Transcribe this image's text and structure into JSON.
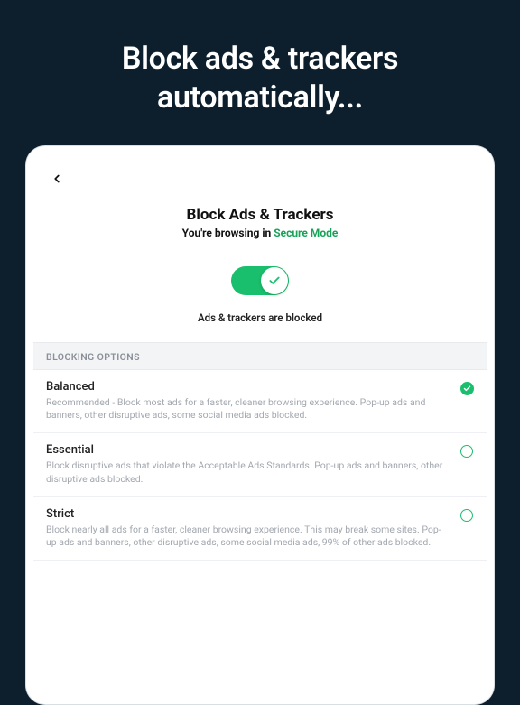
{
  "marketing": {
    "headline_line1": "Block ads & trackers",
    "headline_line2": "automatically..."
  },
  "page": {
    "title": "Block Ads & Trackers",
    "subtitle_prefix": "You're browsing in ",
    "subtitle_mode": "Secure Mode",
    "toggle_on": true,
    "toggle_status": "Ads & trackers are blocked",
    "section_label": "BLOCKING OPTIONS"
  },
  "options": [
    {
      "title": "Balanced",
      "desc": "Recommended - Block most ads for a faster, cleaner browsing experience. Pop-up ads and banners, other disruptive ads, some social media ads blocked.",
      "selected": true
    },
    {
      "title": "Essential",
      "desc": "Block disruptive ads that violate the Acceptable Ads Standards. Pop-up ads and banners, other disruptive ads blocked.",
      "selected": false
    },
    {
      "title": "Strict",
      "desc": "Block nearly all ads for a faster, cleaner browsing experience. This may break some sites. Pop-up ads and banners, other disruptive ads, some social media ads, 99% of other ads blocked.",
      "selected": false
    }
  ],
  "colors": {
    "accent": "#19bf6c",
    "bg": "#0d1f2d"
  }
}
